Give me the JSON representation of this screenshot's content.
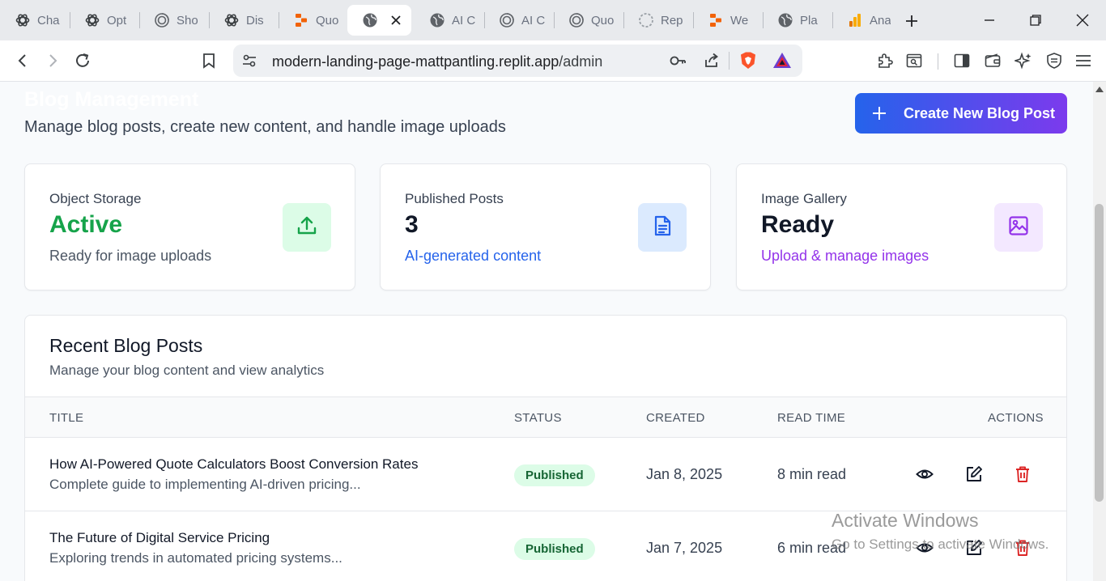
{
  "browser": {
    "tabs": [
      {
        "label": "Cha",
        "icon": "chatgpt-icon"
      },
      {
        "label": "Opt",
        "icon": "chatgpt-icon"
      },
      {
        "label": "Sho",
        "icon": "spiral-icon"
      },
      {
        "label": "Dis",
        "icon": "chatgpt-icon"
      },
      {
        "label": "Quo",
        "icon": "replit-icon"
      },
      {
        "label": "",
        "icon": "globe-icon",
        "active": true
      },
      {
        "label": "AI C",
        "icon": "globe-icon"
      },
      {
        "label": "AI C",
        "icon": "spiral-icon"
      },
      {
        "label": "Quo",
        "icon": "spiral-icon"
      },
      {
        "label": "Rep",
        "icon": "loading-icon"
      },
      {
        "label": "We",
        "icon": "replit-icon"
      },
      {
        "label": "Pla",
        "icon": "globe-icon"
      },
      {
        "label": "Ana",
        "icon": "analytics-icon"
      }
    ],
    "url_host": "modern-landing-page-mattpantling.replit.app",
    "url_path": "/admin"
  },
  "header": {
    "title": "Blog Management",
    "subtitle": "Manage blog posts, create new content, and handle image uploads",
    "create_button": "Create New Blog Post"
  },
  "stats": [
    {
      "label": "Object Storage",
      "value": "Active",
      "note": "Ready for image uploads",
      "icon": "upload-icon",
      "value_color": "#16a34a",
      "note_color": "#4b5563",
      "icon_bg": "#dcfce7",
      "icon_color": "#16a34a"
    },
    {
      "label": "Published Posts",
      "value": "3",
      "note": "AI-generated content",
      "icon": "document-icon",
      "value_color": "#111827",
      "note_color": "#2563eb",
      "icon_bg": "#dbeafe",
      "icon_color": "#2563eb"
    },
    {
      "label": "Image Gallery",
      "value": "Ready",
      "note": "Upload & manage images",
      "icon": "image-icon",
      "value_color": "#111827",
      "note_color": "#9333ea",
      "icon_bg": "#f3e8ff",
      "icon_color": "#9333ea"
    }
  ],
  "posts_section": {
    "title": "Recent Blog Posts",
    "subtitle": "Manage your blog content and view analytics",
    "columns": {
      "title": "TITLE",
      "status": "STATUS",
      "created": "CREATED",
      "read_time": "READ TIME",
      "actions": "ACTIONS"
    },
    "rows": [
      {
        "title": "How AI-Powered Quote Calculators Boost Conversion Rates",
        "excerpt": "Complete guide to implementing AI-driven pricing...",
        "status": "Published",
        "created": "Jan 8, 2025",
        "read_time": "8 min read"
      },
      {
        "title": "The Future of Digital Service Pricing",
        "excerpt": "Exploring trends in automated pricing systems...",
        "status": "Published",
        "created": "Jan 7, 2025",
        "read_time": "6 min read"
      }
    ]
  },
  "watermark": {
    "title": "Activate Windows",
    "subtitle": "Go to Settings to activate Windows."
  }
}
